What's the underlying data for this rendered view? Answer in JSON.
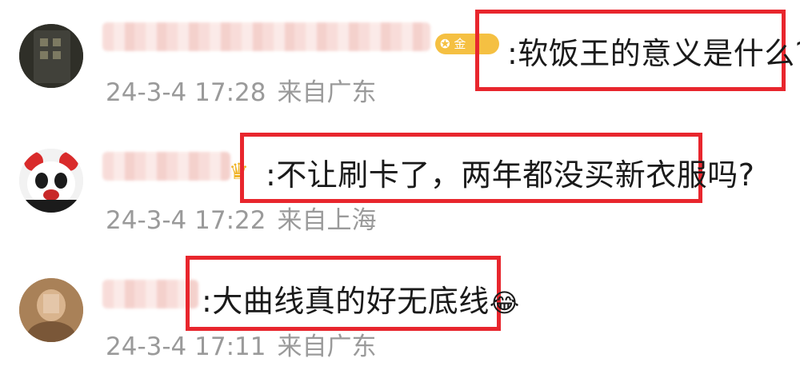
{
  "comments": [
    {
      "badge": "金",
      "text": ":软饭王的意义是什么?",
      "time": "24-3-4 17:28",
      "location": "来自广东"
    },
    {
      "text": ":不让刷卡了，两年都没买新衣服吗?",
      "time": "24-3-4 17:22",
      "location": "来自上海"
    },
    {
      "text": ":大曲线真的好无底线",
      "emoji": "😂",
      "time": "24-3-4 17:11",
      "location": "来自广东"
    }
  ],
  "colors": {
    "highlight": "#e8262d",
    "meta_text": "#9a9a9a",
    "comment_text": "#1a1a1a"
  }
}
